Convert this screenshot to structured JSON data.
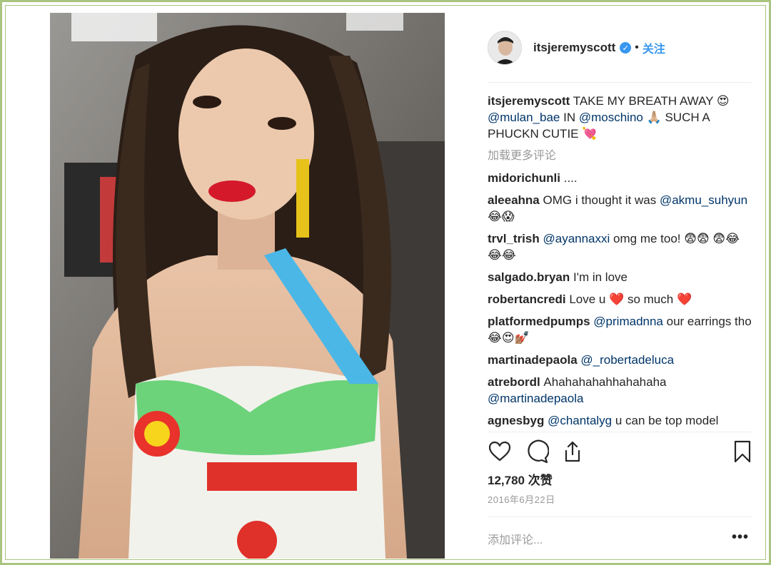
{
  "post": {
    "username": "itsjeremyscott",
    "verified_glyph": "✓",
    "separator": "•",
    "follow_label": "关注",
    "caption": {
      "username": "itsjeremyscott",
      "parts": [
        {
          "t": "TAKE MY BREATH AWAY 😍 "
        },
        {
          "t": "@mulan_bae",
          "m": true
        },
        {
          "t": " IN "
        },
        {
          "t": "@moschino",
          "m": true
        },
        {
          "t": " 🙏🏼 SUCH A PHUCKN CUTIE 💘"
        }
      ]
    },
    "load_more": "加载更多评论",
    "comments": [
      {
        "username": "midorichunli",
        "parts": [
          {
            "t": "...."
          }
        ]
      },
      {
        "username": "aleeahna",
        "parts": [
          {
            "t": "OMG i thought it was "
          },
          {
            "t": "@akmu_suhyun",
            "m": true
          },
          {
            "t": " 😂😱"
          }
        ]
      },
      {
        "username": "trvl_trish",
        "parts": [
          {
            "t": "@ayannaxxi",
            "m": true
          },
          {
            "t": " omg me too! 😨😨 😨😂😂😂"
          }
        ]
      },
      {
        "username": "salgado.bryan",
        "parts": [
          {
            "t": "I'm in love"
          }
        ]
      },
      {
        "username": "robertancredi",
        "parts": [
          {
            "t": "Love u ❤️ so much ❤️"
          }
        ]
      },
      {
        "username": "platformedpumps",
        "parts": [
          {
            "t": "@primadnna",
            "m": true
          },
          {
            "t": " our earrings tho 😂😍💅🏽"
          }
        ]
      },
      {
        "username": "martinadepaola",
        "parts": [
          {
            "t": "@_robertadeluca",
            "m": true
          }
        ]
      },
      {
        "username": "atrebordl",
        "parts": [
          {
            "t": "Ahahahahahhahahaha "
          },
          {
            "t": "@martinadepaola",
            "m": true
          }
        ]
      },
      {
        "username": "agnesbyg",
        "parts": [
          {
            "t": "@chantalyg",
            "m": true
          },
          {
            "t": " u can be top model"
          }
        ]
      }
    ],
    "likes": "12,780 次赞",
    "date": "2016年6月22日",
    "add_comment_placeholder": "添加评论...",
    "more_label": "•••",
    "icons": [
      "heart-icon",
      "comment-icon",
      "share-icon",
      "bookmark-icon"
    ]
  },
  "colors": {
    "border": "#a9c47f",
    "link": "#003569",
    "follow": "#3897f0",
    "muted": "#999999"
  }
}
